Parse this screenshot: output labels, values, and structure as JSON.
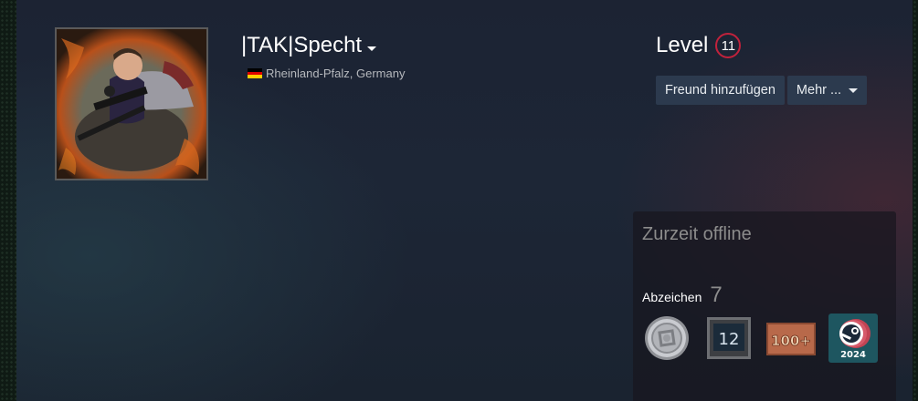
{
  "profile": {
    "persona_name": "|TAK|Specht",
    "location": "Rheinland-Pfalz, Germany",
    "country_flag_colors": [
      "#000000",
      "#dd0000",
      "#ffce00"
    ],
    "avatar_icon": "avatar-image"
  },
  "level": {
    "label": "Level",
    "value": "11",
    "ring_color": "#c0223c"
  },
  "actions": {
    "add_friend_label": "Freund hinzufügen",
    "more_label": "Mehr ..."
  },
  "status_panel": {
    "status_text": "Zurzeit offline",
    "badges_label": "Abzeichen",
    "badges_count": "7",
    "badges": [
      {
        "icon": "coin-badge-icon"
      },
      {
        "icon": "years-of-service-badge-icon",
        "text": "12"
      },
      {
        "icon": "games-owned-badge-icon",
        "text": "100+"
      },
      {
        "icon": "steam-2024-badge-icon",
        "text": "2024"
      }
    ]
  }
}
